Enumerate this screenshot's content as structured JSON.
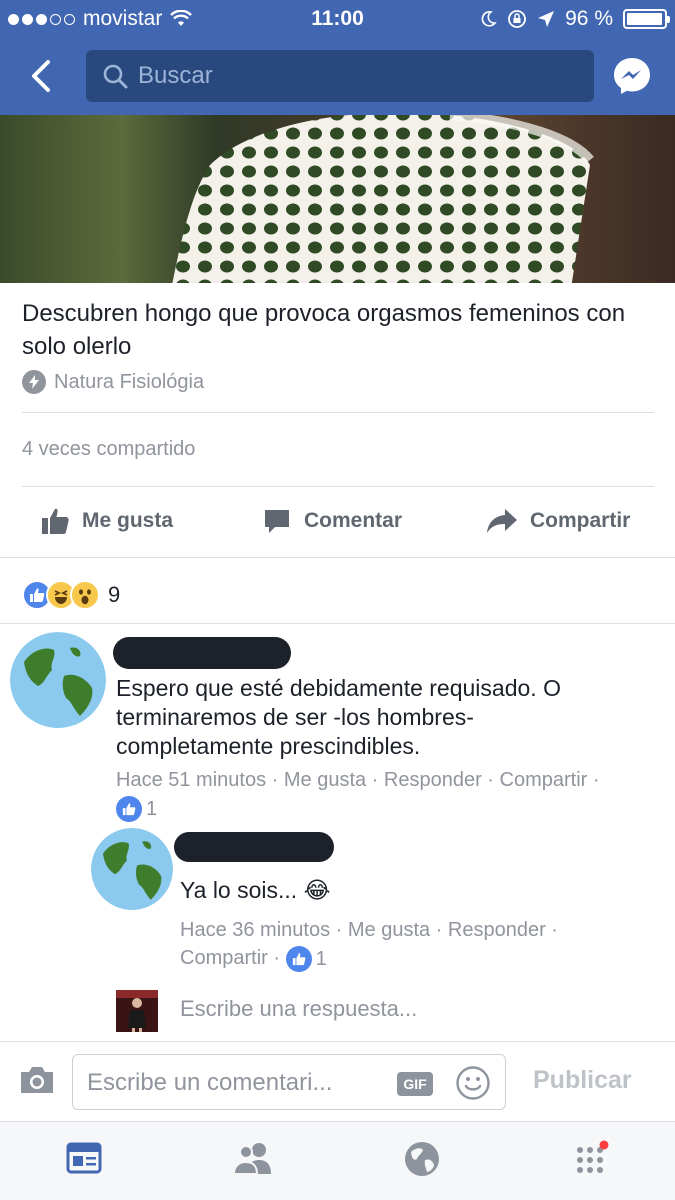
{
  "status_bar": {
    "carrier": "movistar",
    "time": "11:00",
    "battery": "96 %",
    "battery_level": 0.96
  },
  "nav": {
    "search_placeholder": "Buscar"
  },
  "post": {
    "title": "Descubren hongo que provoca orgasmos femeninos con solo olerlo",
    "source": "Natura Fisiológia",
    "shares": "4 veces compartido",
    "actions": {
      "like": "Me gusta",
      "comment": "Comentar",
      "share": "Compartir"
    },
    "reactions": {
      "icons": [
        "like-icon",
        "haha-icon",
        "wow-icon"
      ],
      "count": "9"
    }
  },
  "comments": [
    {
      "text": "Espero que esté debidamente requisado. O terminaremos de ser -los hombres- completamente prescindibles.",
      "time": "Hace 51 minutos",
      "like": "Me gusta",
      "reply": "Responder",
      "share": "Compartir",
      "likes": "1"
    }
  ],
  "replies": [
    {
      "text": "Ya lo sois... 😂",
      "time": "Hace 36 minutos",
      "like": "Me gusta",
      "reply": "Responder",
      "share": "Compartir",
      "likes": "1"
    }
  ],
  "reply_box": {
    "placeholder": "Escribe una respuesta..."
  },
  "composer": {
    "placeholder": "Escribe un comentari...",
    "gif_label": "GIF",
    "publish": "Publicar"
  },
  "tabs": [
    "news-feed-icon",
    "friends-icon",
    "notifications-globe-icon",
    "more-menu-icon"
  ],
  "colors": {
    "brand": "#4267b2",
    "search_bg": "#29487d",
    "like_blue": "#4f86ec",
    "muted": "#90949c"
  }
}
